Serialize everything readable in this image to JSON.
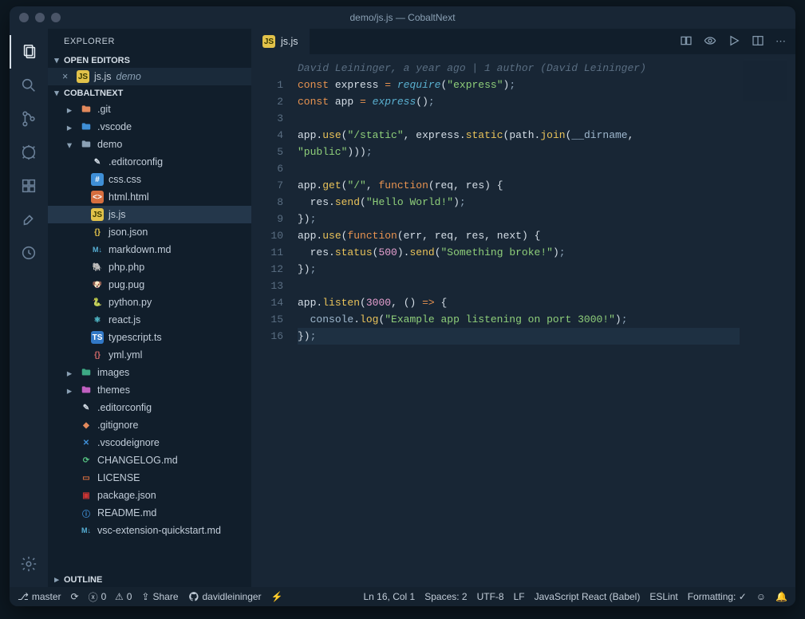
{
  "title": "demo/js.js — CobaltNext",
  "explorer_title": "EXPLORER",
  "sections": {
    "open_editors": "OPEN EDITORS",
    "workspace": "COBALTNEXT",
    "outline": "OUTLINE"
  },
  "open_editors": [
    {
      "file": "js.js",
      "folder": "demo",
      "icon": "js"
    }
  ],
  "tree": [
    {
      "depth": 1,
      "name": ".git",
      "type": "folder",
      "icon": "folder-git",
      "expanded": false
    },
    {
      "depth": 1,
      "name": ".vscode",
      "type": "folder",
      "icon": "folder-vscode",
      "expanded": false
    },
    {
      "depth": 1,
      "name": "demo",
      "type": "folder",
      "icon": "folder-demo",
      "expanded": true
    },
    {
      "depth": 2,
      "name": ".editorconfig",
      "type": "file",
      "icon": "editorconfig"
    },
    {
      "depth": 2,
      "name": "css.css",
      "type": "file",
      "icon": "css"
    },
    {
      "depth": 2,
      "name": "html.html",
      "type": "file",
      "icon": "html"
    },
    {
      "depth": 2,
      "name": "js.js",
      "type": "file",
      "icon": "js",
      "active": true
    },
    {
      "depth": 2,
      "name": "json.json",
      "type": "file",
      "icon": "json"
    },
    {
      "depth": 2,
      "name": "markdown.md",
      "type": "file",
      "icon": "md"
    },
    {
      "depth": 2,
      "name": "php.php",
      "type": "file",
      "icon": "php"
    },
    {
      "depth": 2,
      "name": "pug.pug",
      "type": "file",
      "icon": "pug"
    },
    {
      "depth": 2,
      "name": "python.py",
      "type": "file",
      "icon": "py"
    },
    {
      "depth": 2,
      "name": "react.js",
      "type": "file",
      "icon": "react"
    },
    {
      "depth": 2,
      "name": "typescript.ts",
      "type": "file",
      "icon": "ts"
    },
    {
      "depth": 2,
      "name": "yml.yml",
      "type": "file",
      "icon": "yml"
    },
    {
      "depth": 1,
      "name": "images",
      "type": "folder",
      "icon": "folder-images",
      "expanded": false
    },
    {
      "depth": 1,
      "name": "themes",
      "type": "folder",
      "icon": "folder-themes",
      "expanded": false
    },
    {
      "depth": 1,
      "name": ".editorconfig",
      "type": "file",
      "icon": "editorconfig"
    },
    {
      "depth": 1,
      "name": ".gitignore",
      "type": "file",
      "icon": "gitignore"
    },
    {
      "depth": 1,
      "name": ".vscodeignore",
      "type": "file",
      "icon": "vscodeignore"
    },
    {
      "depth": 1,
      "name": "CHANGELOG.md",
      "type": "file",
      "icon": "changelog"
    },
    {
      "depth": 1,
      "name": "LICENSE",
      "type": "file",
      "icon": "license"
    },
    {
      "depth": 1,
      "name": "package.json",
      "type": "file",
      "icon": "npm"
    },
    {
      "depth": 1,
      "name": "README.md",
      "type": "file",
      "icon": "readme"
    },
    {
      "depth": 1,
      "name": "vsc-extension-quickstart.md",
      "type": "file",
      "icon": "md"
    }
  ],
  "tab": {
    "name": "js.js",
    "icon": "js"
  },
  "blame": "David Leininger, a year ago | 1 author (David Leininger)",
  "code_lines": [
    [
      [
        "kw",
        "const"
      ],
      [
        "sp",
        " "
      ],
      [
        "var",
        "express"
      ],
      [
        "sp",
        " "
      ],
      [
        "op",
        "="
      ],
      [
        "sp",
        " "
      ],
      [
        "fn",
        "require"
      ],
      [
        "punc",
        "("
      ],
      [
        "str",
        "\"express\""
      ],
      [
        "punc",
        ")"
      ],
      [
        "punc-dim",
        ";"
      ]
    ],
    [
      [
        "kw",
        "const"
      ],
      [
        "sp",
        " "
      ],
      [
        "var",
        "app"
      ],
      [
        "sp",
        " "
      ],
      [
        "op",
        "="
      ],
      [
        "sp",
        " "
      ],
      [
        "fn",
        "express"
      ],
      [
        "punc",
        "()"
      ],
      [
        "punc-dim",
        ";"
      ]
    ],
    [],
    [
      [
        "var",
        "app"
      ],
      [
        "punc",
        "."
      ],
      [
        "meth",
        "use"
      ],
      [
        "punc",
        "("
      ],
      [
        "str",
        "\"/static\""
      ],
      [
        "punc",
        ","
      ],
      [
        "sp",
        " "
      ],
      [
        "var",
        "express"
      ],
      [
        "punc",
        "."
      ],
      [
        "meth",
        "static"
      ],
      [
        "punc",
        "("
      ],
      [
        "var",
        "path"
      ],
      [
        "punc",
        "."
      ],
      [
        "meth",
        "join"
      ],
      [
        "punc",
        "("
      ],
      [
        "builtin",
        "__dirname"
      ],
      [
        "punc",
        ","
      ]
    ],
    [
      [
        "str",
        "\"public\""
      ],
      [
        "punc",
        ")))"
      ],
      [
        "punc-dim",
        ";"
      ]
    ],
    [],
    [
      [
        "var",
        "app"
      ],
      [
        "punc",
        "."
      ],
      [
        "meth",
        "get"
      ],
      [
        "punc",
        "("
      ],
      [
        "str",
        "\"/\""
      ],
      [
        "punc",
        ","
      ],
      [
        "sp",
        " "
      ],
      [
        "kw",
        "function"
      ],
      [
        "punc",
        "("
      ],
      [
        "var",
        "req"
      ],
      [
        "punc",
        ","
      ],
      [
        "sp",
        " "
      ],
      [
        "var",
        "res"
      ],
      [
        "punc",
        ")"
      ],
      [
        "sp",
        " "
      ],
      [
        "punc",
        "{"
      ]
    ],
    [
      [
        "sp",
        "  "
      ],
      [
        "var",
        "res"
      ],
      [
        "punc",
        "."
      ],
      [
        "meth",
        "send"
      ],
      [
        "punc",
        "("
      ],
      [
        "str",
        "\"Hello World!\""
      ],
      [
        "punc",
        ")"
      ],
      [
        "punc-dim",
        ";"
      ]
    ],
    [
      [
        "punc",
        "})"
      ],
      [
        "punc-dim",
        ";"
      ]
    ],
    [
      [
        "var",
        "app"
      ],
      [
        "punc",
        "."
      ],
      [
        "meth",
        "use"
      ],
      [
        "punc",
        "("
      ],
      [
        "kw",
        "function"
      ],
      [
        "punc",
        "("
      ],
      [
        "var",
        "err"
      ],
      [
        "punc",
        ","
      ],
      [
        "sp",
        " "
      ],
      [
        "var",
        "req"
      ],
      [
        "punc",
        ","
      ],
      [
        "sp",
        " "
      ],
      [
        "var",
        "res"
      ],
      [
        "punc",
        ","
      ],
      [
        "sp",
        " "
      ],
      [
        "var",
        "next"
      ],
      [
        "punc",
        ")"
      ],
      [
        "sp",
        " "
      ],
      [
        "punc",
        "{"
      ]
    ],
    [
      [
        "sp",
        "  "
      ],
      [
        "var",
        "res"
      ],
      [
        "punc",
        "."
      ],
      [
        "meth",
        "status"
      ],
      [
        "punc",
        "("
      ],
      [
        "num",
        "500"
      ],
      [
        "punc",
        ")."
      ],
      [
        "meth",
        "send"
      ],
      [
        "punc",
        "("
      ],
      [
        "str",
        "\"Something broke!\""
      ],
      [
        "punc",
        ")"
      ],
      [
        "punc-dim",
        ";"
      ]
    ],
    [
      [
        "punc",
        "})"
      ],
      [
        "punc-dim",
        ";"
      ]
    ],
    [],
    [
      [
        "var",
        "app"
      ],
      [
        "punc",
        "."
      ],
      [
        "meth",
        "listen"
      ],
      [
        "punc",
        "("
      ],
      [
        "num",
        "3000"
      ],
      [
        "punc",
        ","
      ],
      [
        "sp",
        " "
      ],
      [
        "punc",
        "()"
      ],
      [
        "sp",
        " "
      ],
      [
        "op",
        "=>"
      ],
      [
        "sp",
        " "
      ],
      [
        "punc",
        "{"
      ]
    ],
    [
      [
        "sp",
        "  "
      ],
      [
        "builtin",
        "console"
      ],
      [
        "punc",
        "."
      ],
      [
        "meth",
        "log"
      ],
      [
        "punc",
        "("
      ],
      [
        "str",
        "\"Example app listening on port 3000!\""
      ],
      [
        "punc",
        ")"
      ],
      [
        "punc-dim",
        ";"
      ]
    ],
    [
      [
        "punc",
        "})"
      ],
      [
        "punc-dim",
        ";"
      ]
    ],
    []
  ],
  "line_count": 16,
  "current_line_index": 15,
  "status": {
    "branch": "master",
    "errors": "0",
    "warnings": "0",
    "share": "Share",
    "github": "davidleininger",
    "cursor": "Ln 16, Col 1",
    "spaces": "Spaces: 2",
    "encoding": "UTF-8",
    "eol": "LF",
    "language": "JavaScript React (Babel)",
    "eslint": "ESLint",
    "formatting": "Formatting: ✓"
  },
  "icons": {
    "folder-git": "▸📁",
    "folder-vscode": "▸📁",
    "folder-demo": "📂",
    "folder-images": "▸📁",
    "folder-themes": "▸📁",
    "js": "JS",
    "json": "{}",
    "css": "#",
    "html": "<>",
    "md": "M↓",
    "php": "🐘",
    "pug": "🐶",
    "py": "🐍",
    "react": "⚛",
    "ts": "TS",
    "yml": "{}",
    "editorconfig": "✎",
    "gitignore": "◆",
    "vscodeignore": "✕",
    "changelog": "⟳",
    "license": "▭",
    "npm": "▣",
    "readme": "ⓘ"
  }
}
